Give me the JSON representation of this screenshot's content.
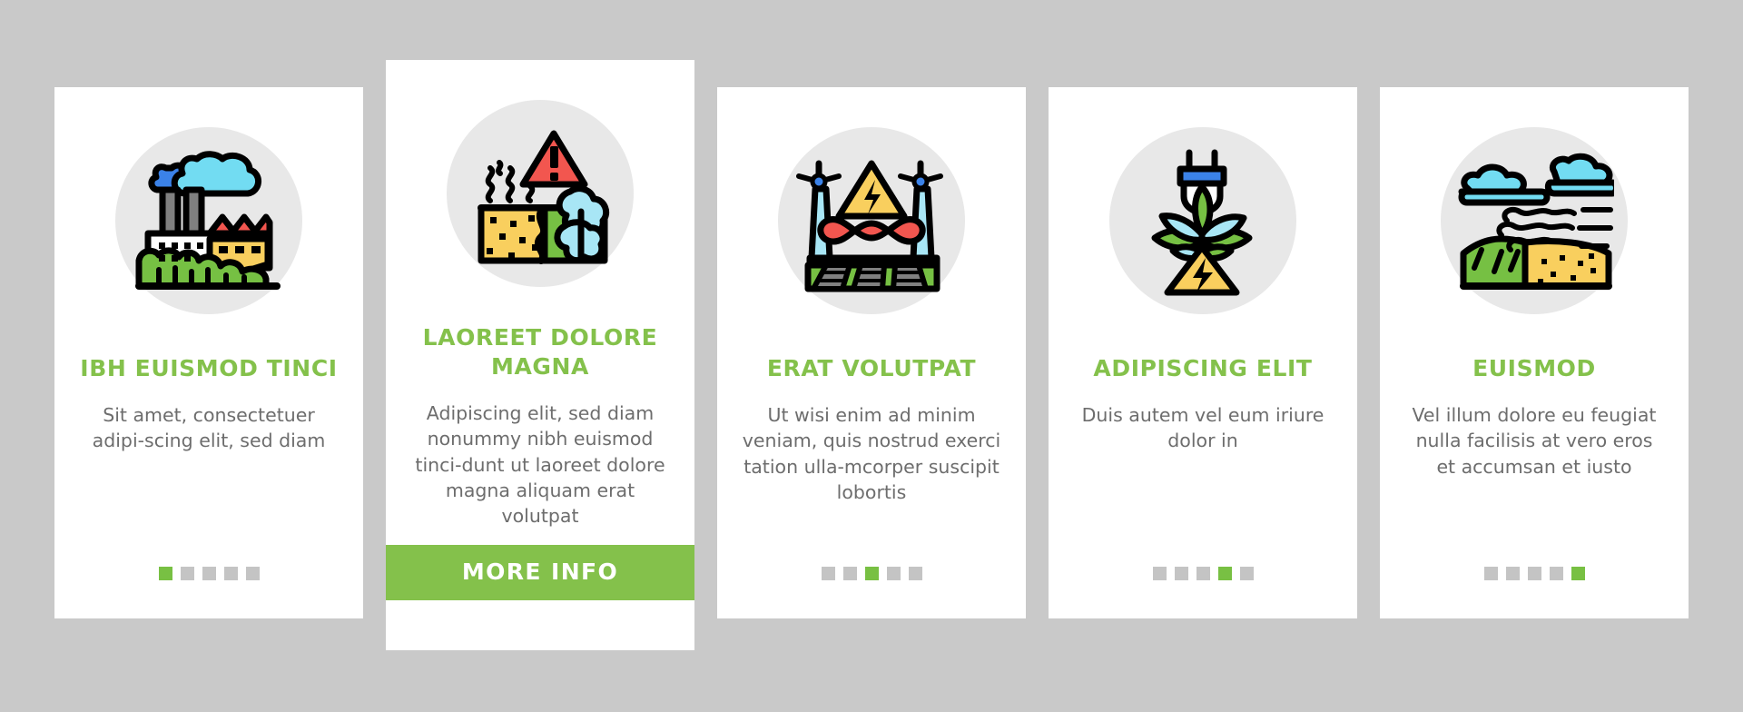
{
  "theme": {
    "background": "#c9c9c9",
    "card_background": "#ffffff",
    "accent_green": "#84c14b",
    "dot_active": "#78c043",
    "dot_inactive": "#c4c4c4",
    "title_color": "#84c14b",
    "body_text_color": "#6d6d6d",
    "icon_circle": "#e8e8e8"
  },
  "cards": [
    {
      "icon_name": "factory-pollution-icon",
      "title": "IBH EUISMOD TINCI",
      "description": "Sit amet, consectetuer adipi-scing elit, sed diam",
      "dots_total": 5,
      "dot_active_index": 1,
      "featured": false
    },
    {
      "icon_name": "contaminated-soil-warning-icon",
      "title": "LAOREET DOLORE MAGNA",
      "description": "Adipiscing elit, sed diam nonummy nibh euismod tinci-dunt ut laoreet dolore magna aliquam erat volutpat",
      "button_label": "MORE INFO",
      "dots_total": 0,
      "dot_active_index": 0,
      "featured": true
    },
    {
      "icon_name": "renewable-energy-infinity-icon",
      "title": "ERAT VOLUTPAT",
      "description": "Ut wisi enim ad minim veniam, quis nostrud exerci tation ulla-mcorper suscipit lobortis",
      "dots_total": 5,
      "dot_active_index": 3,
      "featured": false
    },
    {
      "icon_name": "plug-plant-bioenergy-icon",
      "title": "ADIPISCING ELIT",
      "description": "Duis autem vel eum iriure dolor in",
      "dots_total": 5,
      "dot_active_index": 4,
      "featured": false
    },
    {
      "icon_name": "air-water-pollution-landscape-icon",
      "title": "EUISMOD",
      "description": "Vel illum dolore eu feugiat nulla facilisis at vero eros et accumsan et iusto",
      "dots_total": 5,
      "dot_active_index": 5,
      "featured": false
    }
  ]
}
